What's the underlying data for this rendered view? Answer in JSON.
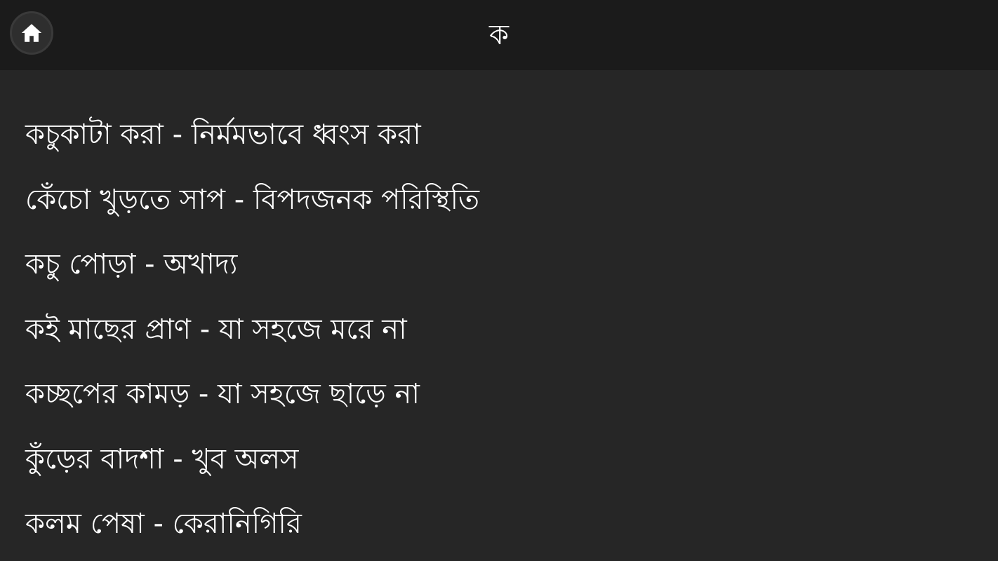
{
  "header": {
    "title": "ক",
    "home_icon": "home-icon"
  },
  "colors": {
    "background": "#262626",
    "header_background": "#1b1b1b",
    "text": "#ffffff"
  },
  "list": {
    "items": [
      "কচুকাটা করা - নির্মমভাবে ধ্বংস করা",
      "কেঁচো খুড়তে সাপ - বিপদজনক পরিস্থিতি",
      "কচু পোড়া - অখাদ্য",
      "কই মাছের প্রাণ - যা সহজে মরে না",
      "কচ্ছপের কামড় - যা সহজে ছাড়ে না",
      "কুঁড়ের বাদশা - খুব অলস",
      "কলম পেষা - কেরানিগিরি"
    ]
  }
}
